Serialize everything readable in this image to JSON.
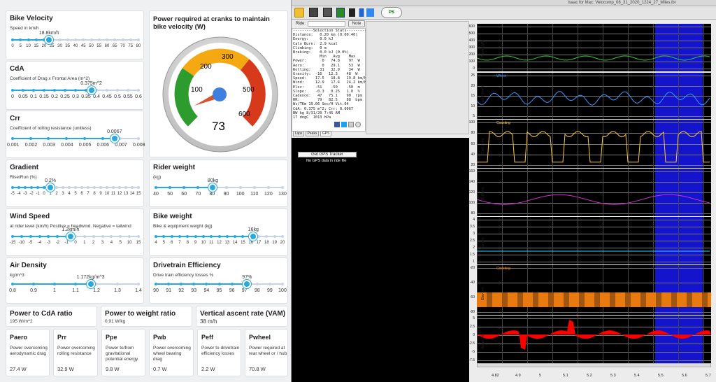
{
  "velocity": {
    "title": "Bike Velocity",
    "sub": "Speed in km/h",
    "value": "18.8km/h",
    "ticks": [
      "0",
      "5",
      "10",
      "15",
      "20",
      "25",
      "30",
      "35",
      "40",
      "45",
      "50",
      "55",
      "60",
      "65",
      "70",
      "75",
      "80"
    ]
  },
  "cda": {
    "title": "CdA",
    "sub": "Coefficient of Drag x Frontal Area (m^2)",
    "value": "0.375m^2",
    "ticks": [
      "0",
      "0.05",
      "0.1",
      "0.15",
      "0.2",
      "0.25",
      "0.3",
      "0.35",
      "0.4",
      "0.45",
      "0.5",
      "0.55",
      "0.6"
    ]
  },
  "crr": {
    "title": "Crr",
    "sub": "Coefficient of rolling resistance (unitless)",
    "value": "0.0067",
    "ticks": [
      "0.001",
      "0.002",
      "0.003",
      "0.004",
      "0.005",
      "0.006",
      "0.007",
      "0.008"
    ]
  },
  "gradient": {
    "title": "Gradient",
    "sub": "Rise/Run (%)",
    "value": "0.2%",
    "ticks": [
      "-5",
      "-4",
      "-3",
      "-2",
      "-1",
      "0",
      "1",
      "2",
      "3",
      "4",
      "5",
      "6",
      "7",
      "8",
      "9",
      "10",
      "11",
      "12",
      "13",
      "14",
      "15"
    ]
  },
  "wind": {
    "title": "Wind Speed",
    "sub": "at rider level (km/h) Positive = headwind. Negative = tailwind",
    "value": "1.2km/h",
    "ticks": [
      "-15",
      "-10",
      "-5",
      "-4",
      "-3",
      "-2",
      "-1",
      "0",
      "1",
      "2",
      "3",
      "4",
      "5",
      "10",
      "15"
    ]
  },
  "density": {
    "title": "Air Density",
    "sub": "kg/m^3",
    "value": "1.172kg/m^3",
    "ticks": [
      "0.8",
      "0.9",
      "1",
      "1.1",
      "1.2",
      "1.3",
      "1.4"
    ]
  },
  "gauge": {
    "title": "Power required at cranks to maintain bike velocity (W)",
    "value": "73",
    "labels": [
      "100",
      "200",
      "300",
      "500",
      "600"
    ]
  },
  "rider": {
    "title": "Rider weight",
    "sub": "(kg)",
    "value": "80kg",
    "ticks": [
      "40",
      "50",
      "60",
      "70",
      "80",
      "90",
      "100",
      "110",
      "120",
      "130"
    ]
  },
  "bike": {
    "title": "Bike weight",
    "sub": "Bike & equipment weight (kg)",
    "value": "16kg",
    "ticks": [
      "4",
      "5",
      "6",
      "7",
      "8",
      "9",
      "10",
      "11",
      "12",
      "13",
      "14",
      "15",
      "16",
      "17",
      "18",
      "19",
      "20"
    ]
  },
  "drivetrain": {
    "title": "Drivetrain Efficiency",
    "sub": "Drive train efficiency losses %",
    "value": "97%",
    "ticks": [
      "90",
      "91",
      "92",
      "93",
      "94",
      "95",
      "96",
      "97",
      "98",
      "99",
      "100"
    ]
  },
  "ratio1": {
    "title": "Power to CdA ratio",
    "value": "195 W/m^2"
  },
  "ratio2": {
    "title": "Power to weight ratio",
    "value": "0.91 W/kg"
  },
  "ratio3": {
    "title": "Vertical ascent rate (VAM)",
    "value": "38 m/h"
  },
  "metrics": [
    {
      "t": "Paero",
      "d": "Power overcoming aerodynamic drag",
      "v": "27.4 W"
    },
    {
      "t": "Prr",
      "d": "Power overcoming rolling resistance",
      "v": "32.9 W"
    },
    {
      "t": "Ppe",
      "d": "Power to/from gravitational potential energy",
      "v": "9.8 W"
    },
    {
      "t": "Pwb",
      "d": "Power overcoming wheel bearing drag",
      "v": "0.7 W"
    },
    {
      "t": "Peff",
      "d": "Power to drivetrain efficiency losses",
      "v": "2.2 W"
    },
    {
      "t": "Pwheel",
      "d": "Power required at rear wheel or / hub",
      "v": "70.8 W"
    }
  ],
  "window": {
    "title": "Isaac for Mac: Velocomp_08_31_2020_1224_27_Miles.ibr",
    "ride_label": "Ride:",
    "note_label": "Note",
    "tabs": [
      "Laps",
      "Peaks",
      "GPS"
    ],
    "gps_button": "Get GPS Tracker",
    "gps_msg": "No GPS data in ride file",
    "logo": "PS",
    "stats": "---------Selection Stats---------\nDistance:   0.20 km (0:00:40)\nEnergy:     0.0 kJ\nCalo Burn:  2.9 kcal\nClimbing:   0 m\nBraking:    0.0 kJ (0.0%)\n            Min   Avg    Max\nPower:       0   74.8    97  W\nAero:        0   29.1    53  W\nRolling:    31   32.9    34  W\nGravity:  -16   12.3    48  W\nSpeed:    17.5   18.8   19.8 km/h\nWind:     12.9   17.4   24.2 km/h\nElev:     -51    -50    -50  m\nSlope:    -0.3   0.25   1.0  %\nCadence:   47   75.1    90  rpm\nHR:        79   82.5    88  bpm\nWs/TKm 19.06 Sec/H Vit.64\nCdA: 0.375 m^2; Crr: 0.0067\nBW kg 8/31/20 7:45 AM\n17 degC  1013 hPa"
  },
  "panels": [
    {
      "label": "Power (W)",
      "ticks": [
        "600",
        "500",
        "400",
        "300",
        "200",
        "100",
        "0"
      ],
      "legend": "",
      "lc": "#3c3"
    },
    {
      "label": "Speed (km/h)",
      "ticks": [
        "25",
        "20",
        "15",
        "10",
        "5"
      ],
      "legend": "Wheel",
      "lc": "#39f"
    },
    {
      "label": "Cad (rpm)",
      "ticks": [
        "100",
        "80",
        "60",
        "40",
        "20"
      ],
      "legend": "Coasting",
      "lc": "#fc3"
    },
    {
      "label": "HR (bpm)",
      "ticks": [
        "160",
        "140",
        "120",
        "100",
        "80"
      ],
      "legend": "",
      "lc": "#c3c"
    },
    {
      "label": "Elev (m)",
      "ticks": [
        "4",
        "3.5",
        "3",
        "2.5",
        "2",
        "1.5",
        "1"
      ],
      "legend": "",
      "lc": "#3cf"
    },
    {
      "label": "Elev (m)",
      "ticks": [
        "-20",
        "-40",
        "-60",
        "-80"
      ],
      "legend": "Coasting",
      "lc": "#f80"
    },
    {
      "label": "Slope (%)",
      "ticks": [
        "5",
        "2.5",
        "0",
        "-2.5",
        "-5",
        "-7.5"
      ],
      "legend": "",
      "lc": "#f00"
    }
  ],
  "xticks": [
    "4.82",
    "4.9",
    "5",
    "5.1",
    "5.2",
    "5.3",
    "5.4",
    "5.5",
    "5.6",
    "5.7"
  ]
}
